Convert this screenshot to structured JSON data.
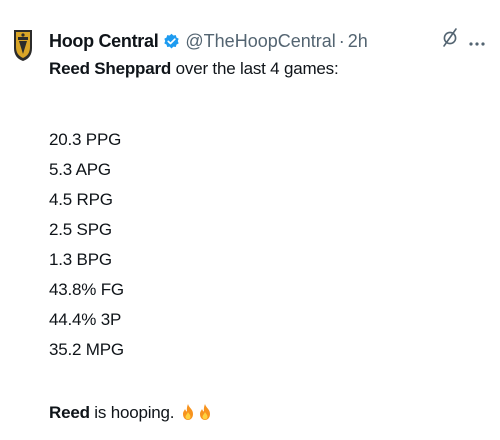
{
  "tweet": {
    "author_name": "Hoop Central",
    "author_handle": "@TheHoopCentral",
    "separator": "·",
    "time": "2h",
    "intro_player": "Reed Sheppard",
    "intro_rest": "over the last 4 games:",
    "stats": [
      "20.3 PPG",
      "5.3 APG",
      "4.5 RPG",
      "2.5 SPG",
      "1.3 BPG",
      "43.8% FG",
      "44.4% 3P",
      "35.2 MPG"
    ],
    "outro_player": "Reed",
    "outro_rest": " is hooping.",
    "emojis": [
      "fire-icon",
      "fire-icon"
    ]
  },
  "colors": {
    "text": "#0f1419",
    "secondary": "#536471",
    "verified": "#1d9bf0",
    "fire": "#f7931e"
  },
  "icons": [
    "verified-badge-icon",
    "grok-icon",
    "more-icon",
    "hoop-central-logo"
  ]
}
